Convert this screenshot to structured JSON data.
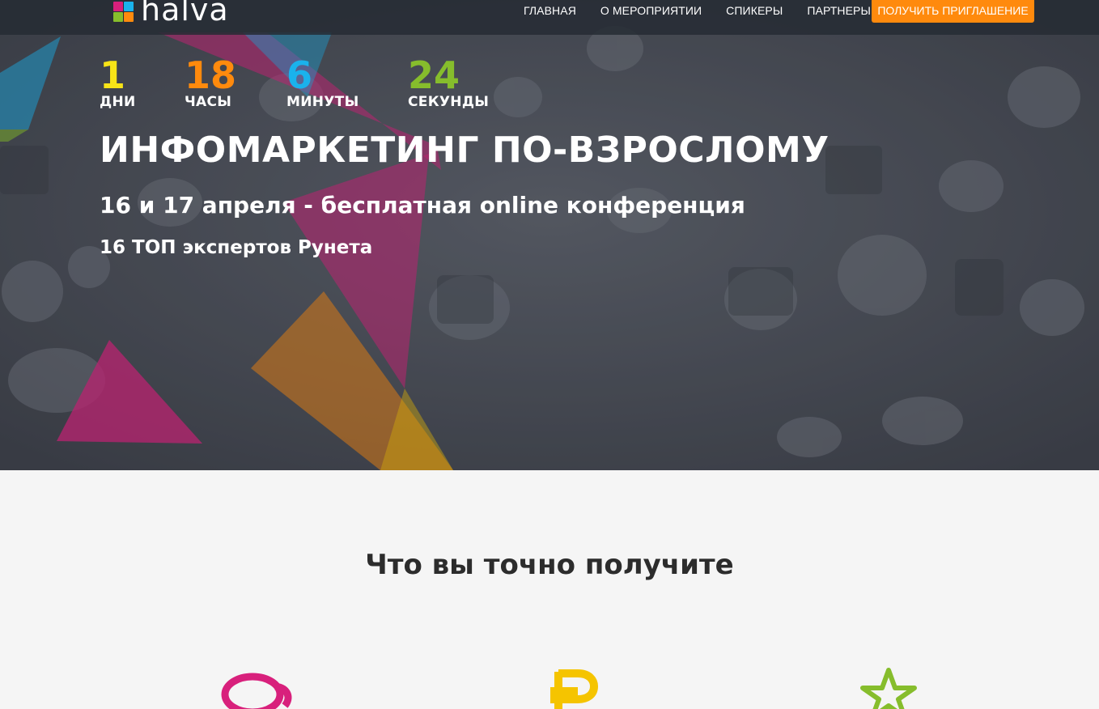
{
  "header": {
    "logo_text": "halva",
    "nav": [
      {
        "label": "ГЛАВНАЯ"
      },
      {
        "label": "О МЕРОПРИЯТИИ"
      },
      {
        "label": "СПИКЕРЫ"
      },
      {
        "label": "ПАРТНЕРЫ"
      }
    ],
    "cta_label": "ПОЛУЧИТЬ ПРИГЛАШЕНИЕ"
  },
  "countdown": [
    {
      "value": "1",
      "label": "ДНИ",
      "color": "#f7e417"
    },
    {
      "value": "18",
      "label": "ЧАСЫ",
      "color": "#ff8a0d"
    },
    {
      "value": "6",
      "label": "МИНУТЫ",
      "color": "#1ab2ec"
    },
    {
      "value": "24",
      "label": "СЕКУНДЫ",
      "color": "#86bd2c"
    }
  ],
  "hero": {
    "title": "ИНФОМАРКЕТИНГ ПО-ВЗРОСЛОМУ",
    "subtitle": "16 и 17 апреля - бесплатная online конференция",
    "subtitle2": "16 ТОП экспертов Рунета"
  },
  "benefits": {
    "title": "Что вы точно получите",
    "icons": [
      {
        "name": "chat-bubbles-icon",
        "color": "#d8207c"
      },
      {
        "name": "ruble-icon",
        "color": "#f5c400"
      },
      {
        "name": "star-icon",
        "color": "#86bd2c"
      }
    ]
  },
  "colors": {
    "accent": "#ff8a0d",
    "nav_bg": "#262b34",
    "section_bg": "#f5f5f5"
  }
}
